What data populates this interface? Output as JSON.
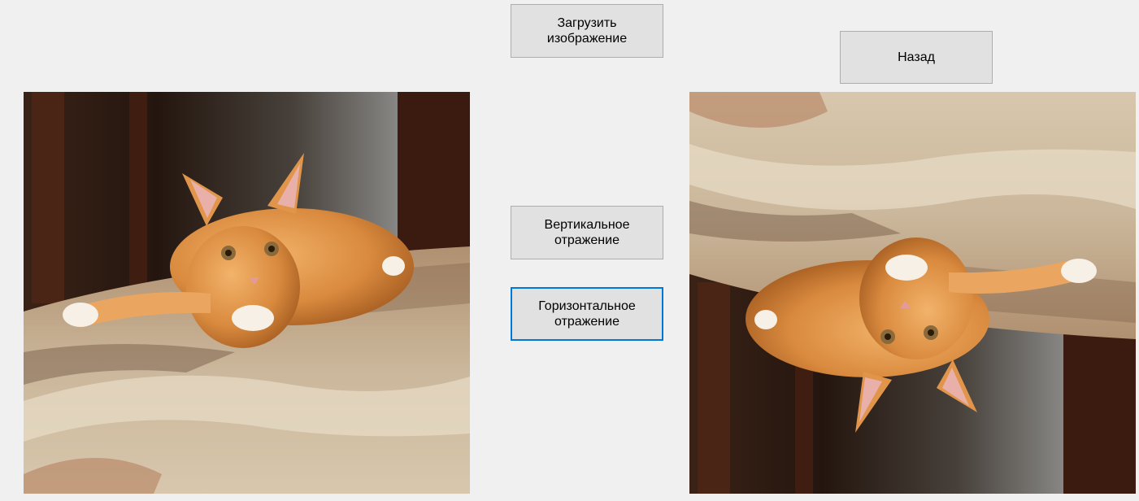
{
  "buttons": {
    "load": "Загрузить\nизображение",
    "back": "Назад",
    "vertical": "Вертикальное\nотражение",
    "horizontal": "Горизонтальное\nотражение"
  },
  "colors": {
    "form_background": "#f0f0f0",
    "button_face": "#e1e1e1",
    "focus_border": "#0078d7"
  },
  "images": {
    "original": {
      "subject": "ginger kitten lying on a beige fluffy rug"
    },
    "result": {
      "subject": "same photo flipped vertically"
    }
  }
}
